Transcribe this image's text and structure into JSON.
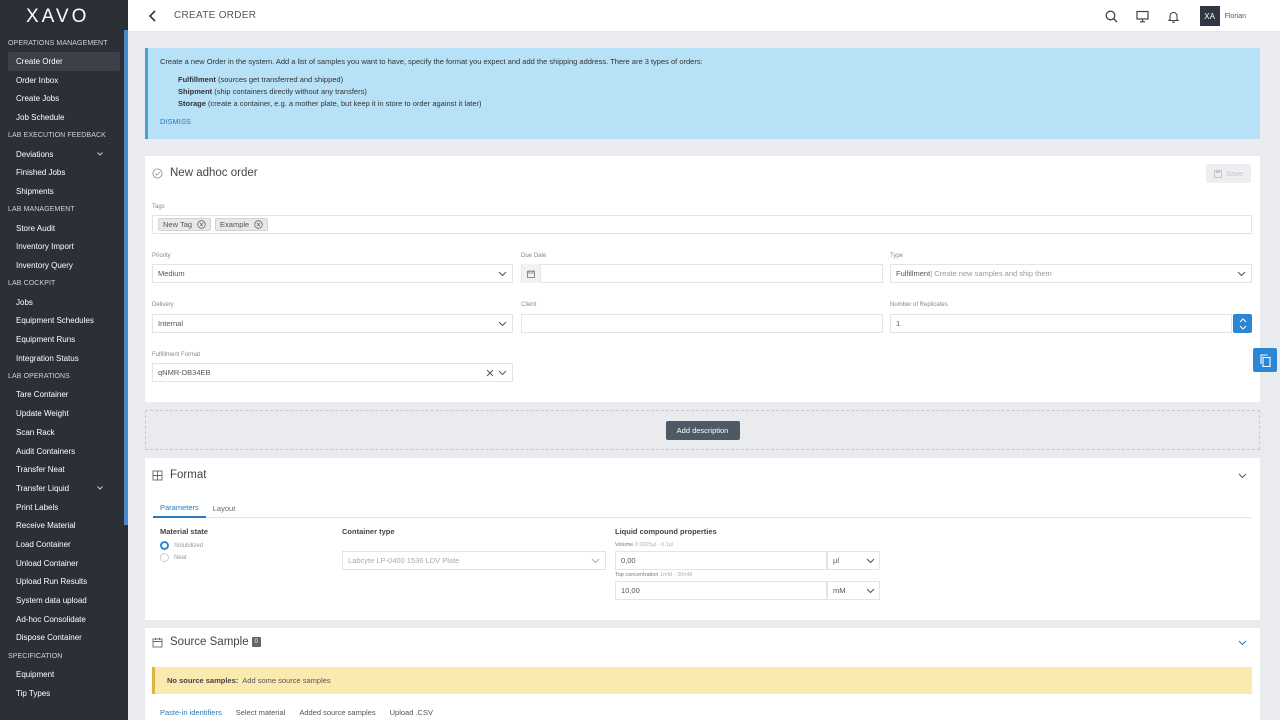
{
  "app": {
    "logo": "XAVO"
  },
  "header": {
    "title": "CREATE ORDER",
    "user_initials": "XA",
    "user_name": "Florian"
  },
  "sidebar": {
    "sections": [
      {
        "title": "OPERATIONS MANAGEMENT",
        "items": [
          {
            "label": "Create Order",
            "active": true
          },
          {
            "label": "Order Inbox"
          },
          {
            "label": "Create Jobs"
          },
          {
            "label": "Job Schedule"
          }
        ]
      },
      {
        "title": "LAB EXECUTION FEEDBACK",
        "items": [
          {
            "label": "Deviations",
            "expandable": true
          },
          {
            "label": "Finished Jobs"
          },
          {
            "label": "Shipments"
          }
        ]
      },
      {
        "title": "LAB MANAGEMENT",
        "items": [
          {
            "label": "Store Audit"
          },
          {
            "label": "Inventory Import"
          },
          {
            "label": "Inventory Query"
          }
        ]
      },
      {
        "title": "LAB COCKPIT",
        "items": [
          {
            "label": "Jobs"
          },
          {
            "label": "Equipment Schedules"
          },
          {
            "label": "Equipment Runs"
          },
          {
            "label": "Integration Status"
          }
        ]
      },
      {
        "title": "LAB OPERATIONS",
        "items": [
          {
            "label": "Tare Container"
          },
          {
            "label": "Update Weight"
          },
          {
            "label": "Scan Rack"
          },
          {
            "label": "Audit Containers"
          },
          {
            "label": "Transfer Neat"
          },
          {
            "label": "Transfer Liquid",
            "expandable": true
          },
          {
            "label": "Print Labels"
          },
          {
            "label": "Receive Material"
          },
          {
            "label": "Load Container"
          },
          {
            "label": "Unload Container"
          },
          {
            "label": "Upload Run Results"
          },
          {
            "label": "System data upload"
          },
          {
            "label": "Ad-hoc Consolidate"
          },
          {
            "label": "Dispose Container"
          }
        ]
      },
      {
        "title": "SPECIFICATION",
        "items": [
          {
            "label": "Equipment"
          },
          {
            "label": "Tip Types"
          }
        ]
      }
    ]
  },
  "banner": {
    "intro": "Create a new Order in the system. Add a list of samples you want to have, specify the format you expect and add the shipping address. There are 3 types of orders:",
    "types": [
      {
        "name": "Fulfillment",
        "desc": " (sources get transferred and shipped)"
      },
      {
        "name": "Shipment",
        "desc": " (ship containers directly without any transfers)"
      },
      {
        "name": "Storage",
        "desc": " (create a container, e.g. a mother plate, but keep it in store to order against it later)"
      }
    ],
    "dismiss": "DISMISS"
  },
  "order": {
    "title": "New adhoc order",
    "save": "Save",
    "tags_label": "Tags",
    "tags": [
      "New Tag",
      "Example"
    ],
    "priority_label": "Priority",
    "priority": "Medium",
    "due_date_label": "Due Date",
    "due_date": "",
    "type_label": "Type",
    "type_value": "Fulfillment",
    "type_desc": " | Create new samples and ship them",
    "delivery_label": "Delivery",
    "delivery": "Internal",
    "client_label": "Client",
    "client": "",
    "replicates_label": "Number of Replicates",
    "replicates": "1",
    "format_label": "Fulfillment Format",
    "format": "qNMR-DB34EB"
  },
  "description_button": "Add description",
  "format": {
    "title": "Format",
    "tabs": [
      "Parameters",
      "Layout"
    ],
    "material_state_label": "Material state",
    "material_states": [
      "Solubilized",
      "Neat"
    ],
    "container_type_label": "Container type",
    "container_type": "Labcyte LP-0400 1536 LDV Plate",
    "liquid_label": "Liquid compound properties",
    "volume_label": "Volume",
    "volume_hint": "0.0025µl - 0.1µl",
    "volume": "0,00",
    "volume_unit": "µl",
    "conc_label": "Top concentration",
    "conc_hint": "1mM - 30mM",
    "conc": "10,00",
    "conc_unit": "mM"
  },
  "source": {
    "title": "Source Sample",
    "count": "0",
    "warning_bold": "No source samples:",
    "warning_text": "Add some source samples",
    "tabs": [
      "Paste-in identifiers",
      "Select material",
      "Added source samples",
      "Upload .CSV"
    ]
  }
}
